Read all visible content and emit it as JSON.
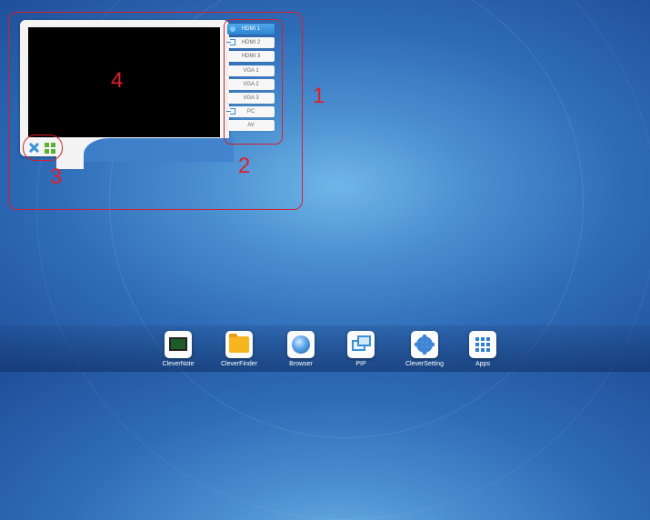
{
  "sources": [
    {
      "label": "HDMI 1",
      "active": true,
      "icon": "dot-icon"
    },
    {
      "label": "HDMI 2",
      "active": false,
      "icon": "input-icon"
    },
    {
      "label": "HDMI 3",
      "active": false,
      "icon": ""
    },
    {
      "label": "VGA 1",
      "active": false,
      "icon": ""
    },
    {
      "label": "VGA 2",
      "active": false,
      "icon": ""
    },
    {
      "label": "VGA 3",
      "active": false,
      "icon": ""
    },
    {
      "label": "PC",
      "active": false,
      "icon": "input-icon"
    },
    {
      "label": "AV",
      "active": false,
      "icon": ""
    }
  ],
  "annotations": {
    "n1": "1",
    "n2": "2",
    "n3": "3",
    "n4": "4"
  },
  "dock": [
    {
      "label": "CleverNote",
      "icon": "clevernote-icon"
    },
    {
      "label": "CleverFinder",
      "icon": "folder-icon"
    },
    {
      "label": "Browser",
      "icon": "browser-icon"
    },
    {
      "label": "PIP",
      "icon": "pip-icon"
    },
    {
      "label": "CleverSetting",
      "icon": "gear-icon"
    },
    {
      "label": "Apps",
      "icon": "apps-grid-icon"
    }
  ],
  "colors": {
    "annotation": "#d81e2a",
    "active_source": "#2e86d3",
    "desktop": "#2f6cb8"
  }
}
